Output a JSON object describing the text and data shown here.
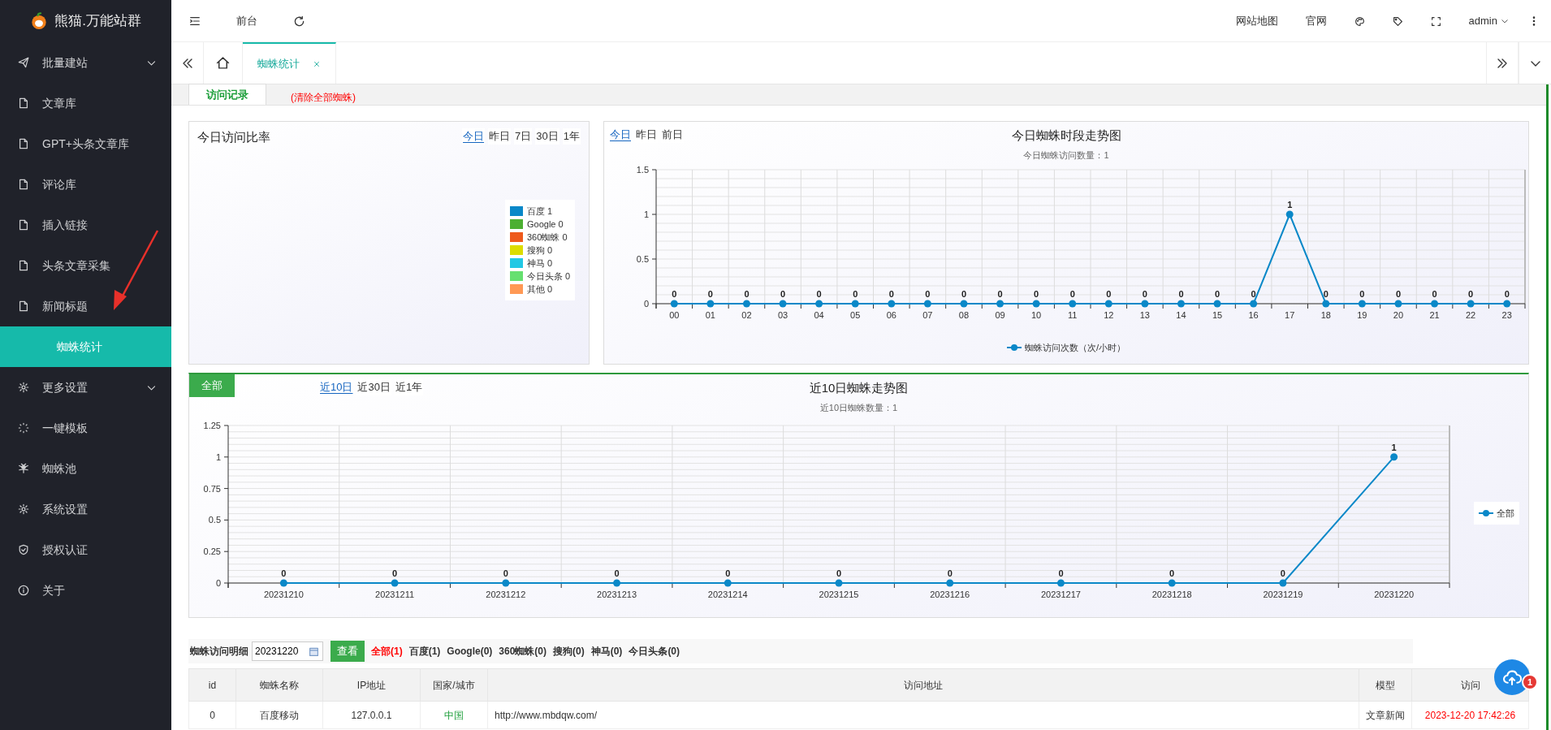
{
  "app": {
    "logo_text": "熊猫.万能站群"
  },
  "sidebar": {
    "items": [
      {
        "label": "批量建站",
        "kind": "parent",
        "expandable": true,
        "selected": false
      },
      {
        "label": "文章库",
        "kind": "page",
        "expandable": false,
        "selected": false
      },
      {
        "label": "GPT+头条文章库",
        "kind": "page",
        "expandable": false,
        "selected": false
      },
      {
        "label": "评论库",
        "kind": "page",
        "expandable": false,
        "selected": false
      },
      {
        "label": "插入链接",
        "kind": "page",
        "expandable": false,
        "selected": false
      },
      {
        "label": "头条文章采集",
        "kind": "page",
        "expandable": false,
        "selected": false
      },
      {
        "label": "新闻标题",
        "kind": "page",
        "expandable": false,
        "selected": false
      },
      {
        "label": "蜘蛛统计",
        "kind": "child",
        "expandable": false,
        "selected": true
      },
      {
        "label": "更多设置",
        "kind": "parent",
        "expandable": true,
        "selected": false
      },
      {
        "label": "一键模板",
        "kind": "page",
        "expandable": false,
        "selected": false
      },
      {
        "label": "蜘蛛池",
        "kind": "page",
        "expandable": false,
        "selected": false
      },
      {
        "label": "系统设置",
        "kind": "page",
        "expandable": false,
        "selected": false
      },
      {
        "label": "授权认证",
        "kind": "page",
        "expandable": false,
        "selected": false
      },
      {
        "label": "关于",
        "kind": "page",
        "expandable": false,
        "selected": false
      }
    ]
  },
  "topbar": {
    "left_links": [
      "前台"
    ],
    "right_links": [
      "网站地图",
      "官网"
    ],
    "user": "admin"
  },
  "page_tabs": [
    {
      "label": "蜘蛛统计",
      "selected": true
    }
  ],
  "sub_tabs": [
    {
      "label": "访问记录",
      "kind": "tab",
      "selected": true
    },
    {
      "label": "(清除全部蜘蛛)",
      "kind": "danger",
      "selected": false
    }
  ],
  "ratio_panel": {
    "title": "今日访问比率",
    "periods": [
      {
        "label": "今日",
        "selected": true
      },
      {
        "label": "昨日",
        "selected": false
      },
      {
        "label": "7日",
        "selected": false
      },
      {
        "label": "30日",
        "selected": false
      },
      {
        "label": "1年",
        "selected": false
      }
    ],
    "legend": [
      {
        "label": "百度 1",
        "color": "#0a88c8"
      },
      {
        "label": "Google 0",
        "color": "#4caf32"
      },
      {
        "label": "360蜘蛛 0",
        "color": "#ee5a1c"
      },
      {
        "label": "搜狗 0",
        "color": "#dddd00"
      },
      {
        "label": "神马 0",
        "color": "#22c8e4"
      },
      {
        "label": "今日头条 0",
        "color": "#66e070"
      },
      {
        "label": "其他 0",
        "color": "#ff9955"
      }
    ]
  },
  "hourly_panel": {
    "periods": [
      {
        "label": "今日",
        "selected": true
      },
      {
        "label": "昨日",
        "selected": false
      },
      {
        "label": "前日",
        "selected": false
      }
    ],
    "subtitle": "今日蜘蛛访问数量：1",
    "chart_data": {
      "type": "line",
      "title": "今日蜘蛛时段走势图",
      "categories": [
        "00",
        "01",
        "02",
        "03",
        "04",
        "05",
        "06",
        "07",
        "08",
        "09",
        "10",
        "11",
        "12",
        "13",
        "14",
        "15",
        "16",
        "17",
        "18",
        "19",
        "20",
        "21",
        "22",
        "23"
      ],
      "series": [
        {
          "name": "蜘蛛访问次数（次/小时）",
          "color": "#0a88c8",
          "values": [
            0,
            0,
            0,
            0,
            0,
            0,
            0,
            0,
            0,
            0,
            0,
            0,
            0,
            0,
            0,
            0,
            0,
            1,
            0,
            0,
            0,
            0,
            0,
            0
          ]
        }
      ],
      "ylim": [
        0,
        1.5
      ],
      "yticks": [
        0,
        0.5,
        1,
        1.5
      ],
      "data_labels": true,
      "grid": true,
      "marker": true
    }
  },
  "daily_panel": {
    "filter_button": "全部",
    "periods": [
      {
        "label": "近10日",
        "selected": true
      },
      {
        "label": "近30日",
        "selected": false
      },
      {
        "label": "近1年",
        "selected": false
      }
    ],
    "subtitle": "近10日蜘蛛数量：1",
    "chart_data": {
      "type": "line",
      "title": "近10日蜘蛛走势图",
      "categories": [
        "20231210",
        "20231211",
        "20231212",
        "20231213",
        "20231214",
        "20231215",
        "20231216",
        "20231217",
        "20231218",
        "20231219",
        "20231220"
      ],
      "series": [
        {
          "name": "全部",
          "color": "#0a88c8",
          "values": [
            0,
            0,
            0,
            0,
            0,
            0,
            0,
            0,
            0,
            0,
            1
          ]
        }
      ],
      "ylim": [
        0,
        1.25
      ],
      "yticks": [
        0,
        0.25,
        0.5,
        0.75,
        1,
        1.25
      ],
      "data_labels": true,
      "grid": true,
      "marker": true
    }
  },
  "detail": {
    "label": "蜘蛛访问明细",
    "date_value": "20231220",
    "search_button": "查看",
    "filters": [
      {
        "label": "全部(1)",
        "selected": true
      },
      {
        "label": "百度(1)",
        "selected": false
      },
      {
        "label": "Google(0)",
        "selected": false
      },
      {
        "label": "360蜘蛛(0)",
        "selected": false
      },
      {
        "label": "搜狗(0)",
        "selected": false
      },
      {
        "label": "神马(0)",
        "selected": false
      },
      {
        "label": "今日头条(0)",
        "selected": false
      }
    ],
    "table": {
      "columns": [
        "id",
        "蜘蛛名称",
        "IP地址",
        "国家/城市",
        "访问地址",
        "模型",
        "访问"
      ],
      "rows": [
        {
          "cells": [
            "0",
            "百度移动",
            "127.0.0.1",
            "中国",
            "http://www.mbdqw.com/",
            "文章新闻",
            "2023-12-20 17:42:26"
          ]
        }
      ]
    }
  },
  "upload_badge": "1"
}
